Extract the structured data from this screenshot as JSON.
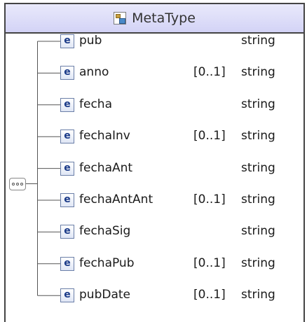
{
  "complex_type": {
    "name": "MetaType",
    "icon": "complex-type-icon"
  },
  "compositor": {
    "kind": "sequence",
    "icon": "sequence-icon"
  },
  "element_icon_letter": "e",
  "elements": [
    {
      "name": "pub",
      "occurs": "",
      "type": "string"
    },
    {
      "name": "anno",
      "occurs": "[0..1]",
      "type": "string"
    },
    {
      "name": "fecha",
      "occurs": "",
      "type": "string"
    },
    {
      "name": "fechaInv",
      "occurs": "[0..1]",
      "type": "string"
    },
    {
      "name": "fechaAnt",
      "occurs": "",
      "type": "string"
    },
    {
      "name": "fechaAntAnt",
      "occurs": "[0..1]",
      "type": "string"
    },
    {
      "name": "fechaSig",
      "occurs": "",
      "type": "string"
    },
    {
      "name": "fechaPub",
      "occurs": "[0..1]",
      "type": "string"
    },
    {
      "name": "pubDate",
      "occurs": "[0..1]",
      "type": "string"
    }
  ],
  "colors": {
    "header_bg": "#dcdcf8",
    "border": "#444444",
    "element_letter": "#1a3a88"
  }
}
